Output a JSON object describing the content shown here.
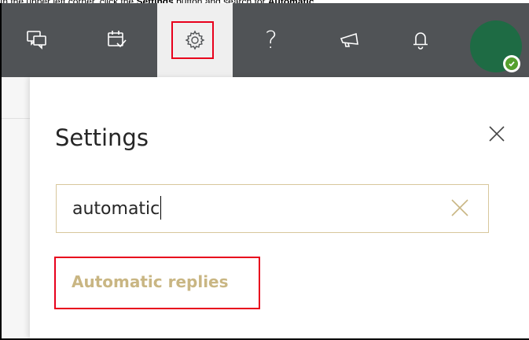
{
  "instruction": {
    "prefix": "In the upper left corner, click the ",
    "settings_word": "Settings",
    "middle": " button and search for ",
    "automatic_word": "Automatic"
  },
  "topbar": {
    "icons": [
      {
        "name": "feedback-chat-icon"
      },
      {
        "name": "calendar-check-icon"
      },
      {
        "name": "gear-icon",
        "active": true
      },
      {
        "name": "help-icon",
        "glyph": "?"
      },
      {
        "name": "megaphone-icon"
      },
      {
        "name": "bell-icon"
      }
    ],
    "help_glyph": "?",
    "colors": {
      "bar": "#505356",
      "active_tab": "#efefef",
      "avatar": "#1e6b44",
      "status": "#55a02e"
    }
  },
  "settings_panel": {
    "title": "Settings",
    "search": {
      "value": "automatic"
    },
    "results": [
      {
        "label": "Automatic replies"
      }
    ],
    "colors": {
      "result_link": "#c9b683",
      "search_border": "#d8c79c",
      "highlight": "#e8001c"
    }
  }
}
